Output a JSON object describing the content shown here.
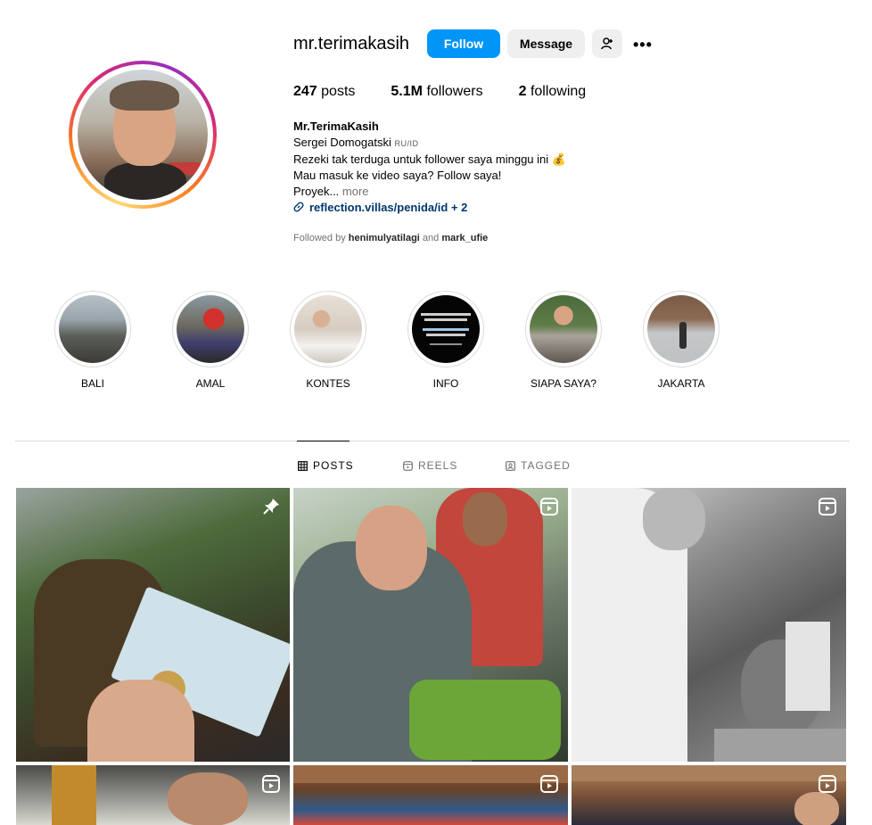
{
  "profile": {
    "username": "mr.terimakasih",
    "follow_label": "Follow",
    "message_label": "Message",
    "stats": {
      "posts_count": "247",
      "posts_label": "posts",
      "followers_count": "5.1M",
      "followers_label": "followers",
      "following_count": "2",
      "following_label": "following"
    },
    "bio": {
      "display_name": "Mr.TerimaKasih",
      "line1": "Sergei Domogatski",
      "pronouns": "RU/ID",
      "line2": "Rezeki tak terduga untuk follower saya minggu ini 💰",
      "line3": "Mau masuk ke video saya? Follow saya!",
      "line4": "Proyek...",
      "more": "more",
      "link": "reflection.villas/penida/id + 2"
    },
    "followed_by": {
      "prefix": "Followed by",
      "user1": "henimulyatilagi",
      "joiner": "and",
      "user2": "mark_ufie"
    }
  },
  "highlights": [
    {
      "label": "BALI"
    },
    {
      "label": "AMAL"
    },
    {
      "label": "KONTES"
    },
    {
      "label": "INFO"
    },
    {
      "label": "SIAPA SAYA?"
    },
    {
      "label": "JAKARTA"
    }
  ],
  "tabs": [
    {
      "label": "POSTS",
      "active": true
    },
    {
      "label": "REELS",
      "active": false
    },
    {
      "label": "TAGGED",
      "active": false
    }
  ],
  "posts": [
    {
      "badge": "pin-icon"
    },
    {
      "badge": "reel-icon"
    },
    {
      "badge": "reel-icon"
    },
    {
      "badge": "reel-icon"
    },
    {
      "badge": "reel-icon"
    },
    {
      "badge": "reel-icon"
    }
  ],
  "colors": {
    "follow_button": "#0095f6",
    "secondary_button": "#efefef",
    "link": "#00376b",
    "muted_text": "#737373",
    "divider": "#dbdbdb"
  }
}
